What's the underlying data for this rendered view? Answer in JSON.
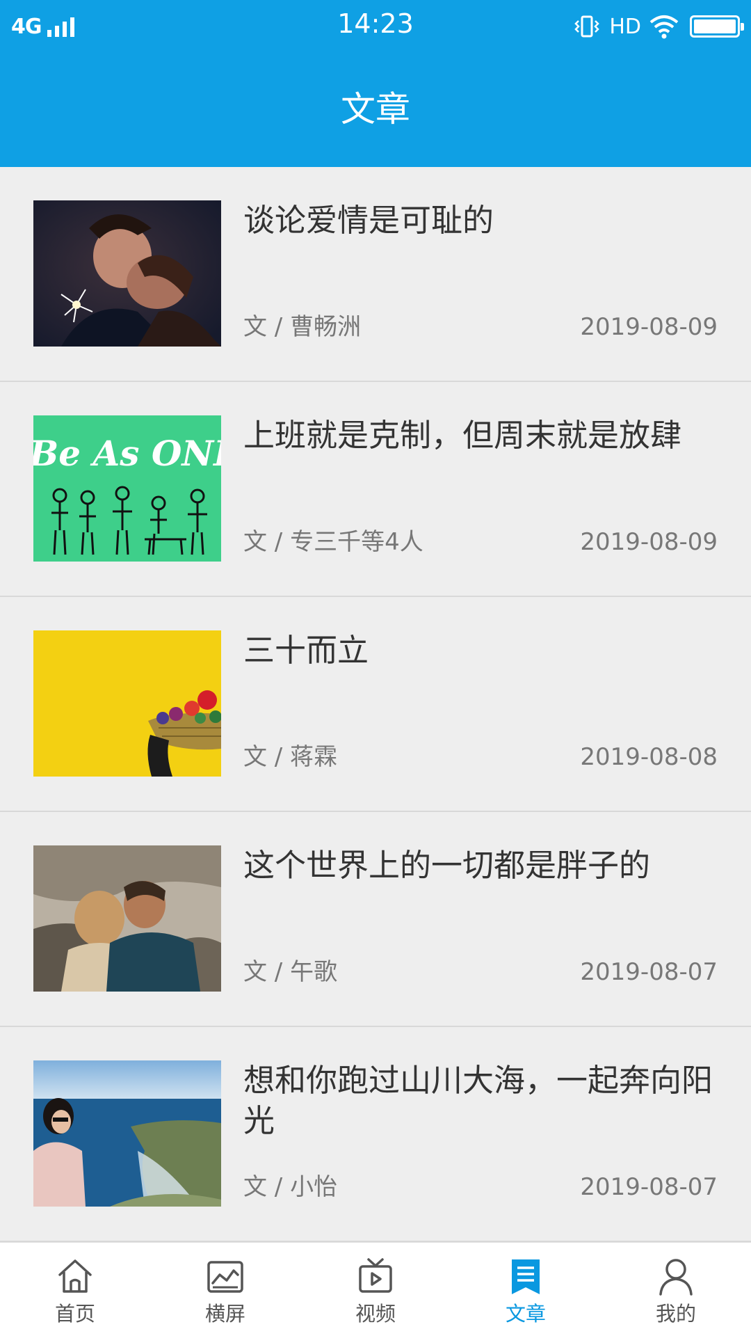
{
  "status_bar": {
    "network": "4G",
    "time": "14:23",
    "hd": "HD"
  },
  "header": {
    "title": "文章"
  },
  "articles": [
    {
      "title": "谈论爱情是可耻的",
      "author": "文 / 曹畅洲",
      "date": "2019-08-09",
      "image_icon": "couple-kiss-photo"
    },
    {
      "title": "上班就是克制，但周末就是放肆",
      "author": "文 / 专三千等4人",
      "date": "2019-08-09",
      "image_icon": "be-as-one-illustration",
      "image_text": "Be As ONE"
    },
    {
      "title": "三十而立",
      "author": "文 / 蒋霖",
      "date": "2019-08-08",
      "image_icon": "flower-basket-photo"
    },
    {
      "title": "这个世界上的一切都是胖子的",
      "author": "文 / 午歌",
      "date": "2019-08-07",
      "image_icon": "couple-on-rocks-photo"
    },
    {
      "title": "想和你跑过山川大海，一起奔向阳光",
      "author": "文 / 小怡",
      "date": "2019-08-07",
      "image_icon": "seaside-woman-photo"
    }
  ],
  "tabs": [
    {
      "label": "首页",
      "icon": "home-icon",
      "active": false
    },
    {
      "label": "横屏",
      "icon": "landscape-icon",
      "active": false
    },
    {
      "label": "视频",
      "icon": "tv-icon",
      "active": false
    },
    {
      "label": "文章",
      "icon": "article-icon",
      "active": true
    },
    {
      "label": "我的",
      "icon": "profile-icon",
      "active": false
    }
  ],
  "colors": {
    "header_bg": "#0fa0e4",
    "tab_active": "#0a98e0",
    "tab_inactive": "#555555",
    "list_bg": "#eeeeee"
  }
}
